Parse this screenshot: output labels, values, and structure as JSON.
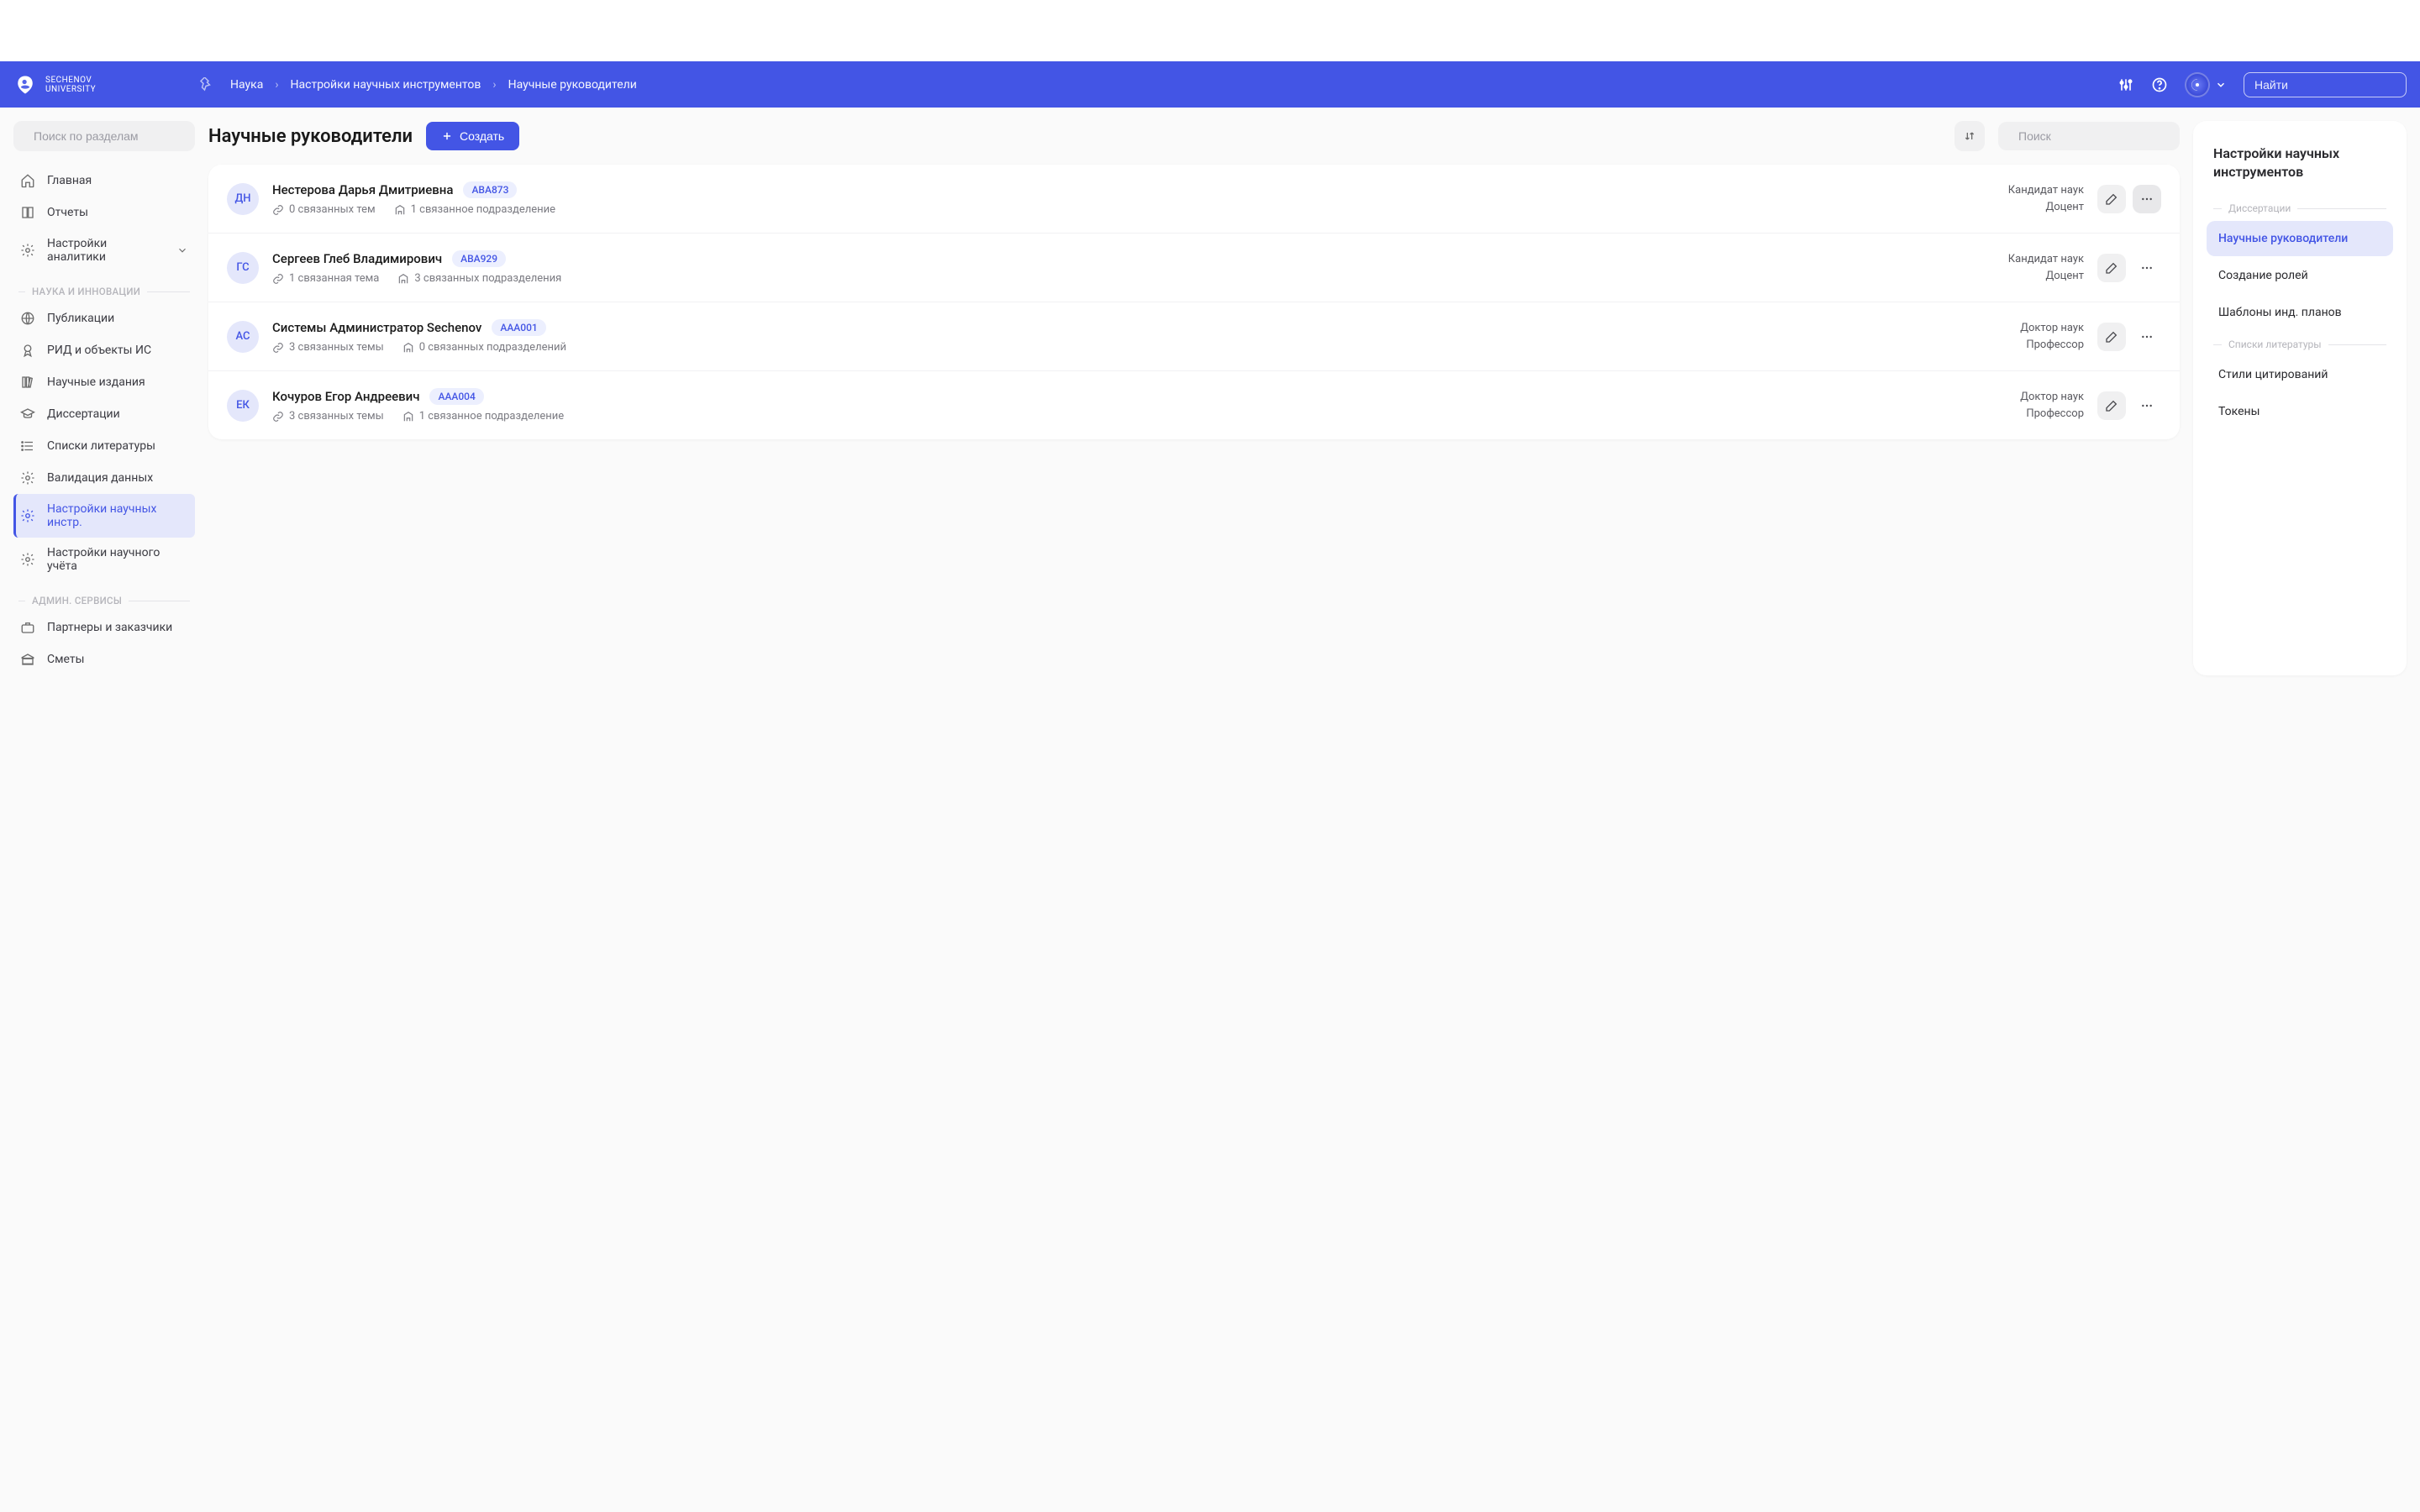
{
  "brand": {
    "line1": "SECHENOV",
    "line2": "UNIVERSITY"
  },
  "breadcrumb": [
    "Наука",
    "Настройки научных инструментов",
    "Научные руководители"
  ],
  "global_search_placeholder": "Найти",
  "sidebar": {
    "search_placeholder": "Поиск по разделам",
    "items_top": [
      {
        "label": "Главная",
        "icon": "home"
      },
      {
        "label": "Отчеты",
        "icon": "book"
      },
      {
        "label": "Настройки аналитики",
        "icon": "gear",
        "expandable": true
      }
    ],
    "group_science_label": "НАУКА И ИННОВАЦИИ",
    "items_science": [
      {
        "label": "Публикации",
        "icon": "globe"
      },
      {
        "label": "РИД и объекты ИС",
        "icon": "award"
      },
      {
        "label": "Научные издания",
        "icon": "books"
      },
      {
        "label": "Диссертации",
        "icon": "graduation"
      },
      {
        "label": "Списки литературы",
        "icon": "list"
      },
      {
        "label": "Валидация данных",
        "icon": "gear"
      },
      {
        "label": "Настройки научных инстр.",
        "icon": "gear",
        "active": true
      },
      {
        "label": "Настройки научного учёта",
        "icon": "gear"
      }
    ],
    "group_admin_label": "АДМИН. СЕРВИСЫ",
    "items_admin": [
      {
        "label": "Партнеры и заказчики",
        "icon": "briefcase"
      },
      {
        "label": "Сметы",
        "icon": "bank"
      }
    ]
  },
  "page_title": "Научные руководители",
  "create_label": "Создать",
  "list_search_placeholder": "Поиск",
  "people": [
    {
      "initials": "ДН",
      "name": "Нестерова Дарья Дмитриевна",
      "code": "АВА873",
      "topics": "0 связанных тем",
      "departments": "1 связанное подразделение",
      "degree": "Кандидат наук",
      "position": "Доцент",
      "more_dark": true
    },
    {
      "initials": "ГС",
      "name": "Сергеев Глеб Владимирович",
      "code": "АВА929",
      "topics": "1 связанная тема",
      "departments": "3 связанных подразделения",
      "degree": "Кандидат наук",
      "position": "Доцент",
      "more_dark": false
    },
    {
      "initials": "АС",
      "name": "Системы Администратор Sechenov",
      "code": "ААА001",
      "topics": "3 связанных темы",
      "departments": "0 связанных подразделений",
      "degree": "Доктор наук",
      "position": "Профессор",
      "more_dark": false
    },
    {
      "initials": "ЕК",
      "name": "Кочуров Егор Андреевич",
      "code": "ААА004",
      "topics": "3 связанных темы",
      "departments": "1 связанное подразделение",
      "degree": "Доктор наук",
      "position": "Профессор",
      "more_dark": false
    }
  ],
  "right_panel": {
    "title": "Настройки научных инструментов",
    "group1_label": "Диссертации",
    "group1_items": [
      {
        "label": "Научные руководители",
        "active": true
      },
      {
        "label": "Создание ролей"
      },
      {
        "label": "Шаблоны инд. планов"
      }
    ],
    "group2_label": "Списки литературы",
    "group2_items": [
      {
        "label": "Стили цитирований"
      },
      {
        "label": "Токены"
      }
    ]
  }
}
